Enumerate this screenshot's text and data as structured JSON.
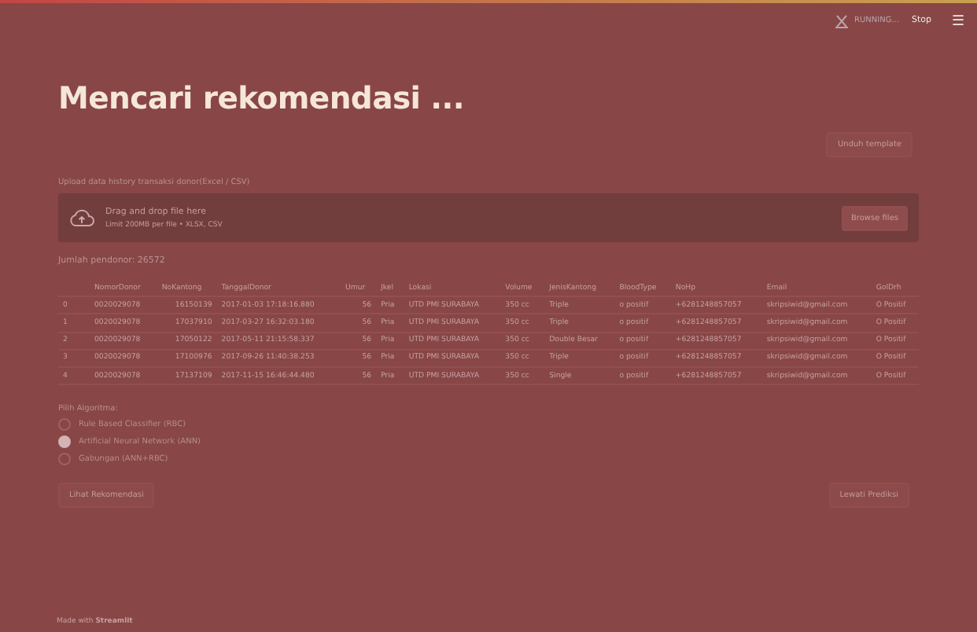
{
  "header": {
    "status": "RUNNING...",
    "stop": "Stop",
    "menu": "☰"
  },
  "title": "Mencari rekomendasi ...",
  "template_button": "Unduh template",
  "uploader": {
    "label": "Upload data history transaksi donor(Excel / CSV)",
    "drop_text": "Drag and drop file here",
    "limit": "Limit 200MB per file • XLSX, CSV",
    "button": "Browse files"
  },
  "donor_count": "Jumlah pendonor: 26572",
  "table": {
    "columns": [
      "",
      "NomorDonor",
      "NoKantong",
      "TanggalDonor",
      "Umur",
      "Jkel",
      "Lokasi",
      "Volume",
      "JenisKantong",
      "BloodType",
      "NoHp",
      "Email",
      "GolDrh"
    ],
    "rows": [
      [
        "0",
        "0020029078",
        "16150139",
        "2017-01-03 17:18:16.880",
        "56",
        "Pria",
        "UTD PMI SURABAYA",
        "350 cc",
        "Triple",
        "o positif",
        "+6281248857057",
        "skripsiwid@gmail.com",
        "O Positif"
      ],
      [
        "1",
        "0020029078",
        "17037910",
        "2017-03-27 16:32:03.180",
        "56",
        "Pria",
        "UTD PMI SURABAYA",
        "350 cc",
        "Triple",
        "o positif",
        "+6281248857057",
        "skripsiwid@gmail.com",
        "O Positif"
      ],
      [
        "2",
        "0020029078",
        "17050122",
        "2017-05-11 21:15:58.337",
        "56",
        "Pria",
        "UTD PMI SURABAYA",
        "350 cc",
        "Double Besar",
        "o positif",
        "+6281248857057",
        "skripsiwid@gmail.com",
        "O Positif"
      ],
      [
        "3",
        "0020029078",
        "17100976",
        "2017-09-26 11:40:38.253",
        "56",
        "Pria",
        "UTD PMI SURABAYA",
        "350 cc",
        "Triple",
        "o positif",
        "+6281248857057",
        "skripsiwid@gmail.com",
        "O Positif"
      ],
      [
        "4",
        "0020029078",
        "17137109",
        "2017-11-15 16:46:44.480",
        "56",
        "Pria",
        "UTD PMI SURABAYA",
        "350 cc",
        "Single",
        "o positif",
        "+6281248857057",
        "skripsiwid@gmail.com",
        "O Positif"
      ]
    ]
  },
  "algorithm": {
    "label": "Pilih Algoritma:",
    "options": [
      {
        "label": "Rule Based Classifier (RBC)",
        "selected": false
      },
      {
        "label": "Artificial Neural Network (ANN)",
        "selected": true
      },
      {
        "label": "Gabungan (ANN+RBC)",
        "selected": false
      }
    ]
  },
  "buttons": [
    "Lihat Rekomendasi",
    "Lewati Prediksi"
  ],
  "footer": "Made with **Streamlit**"
}
